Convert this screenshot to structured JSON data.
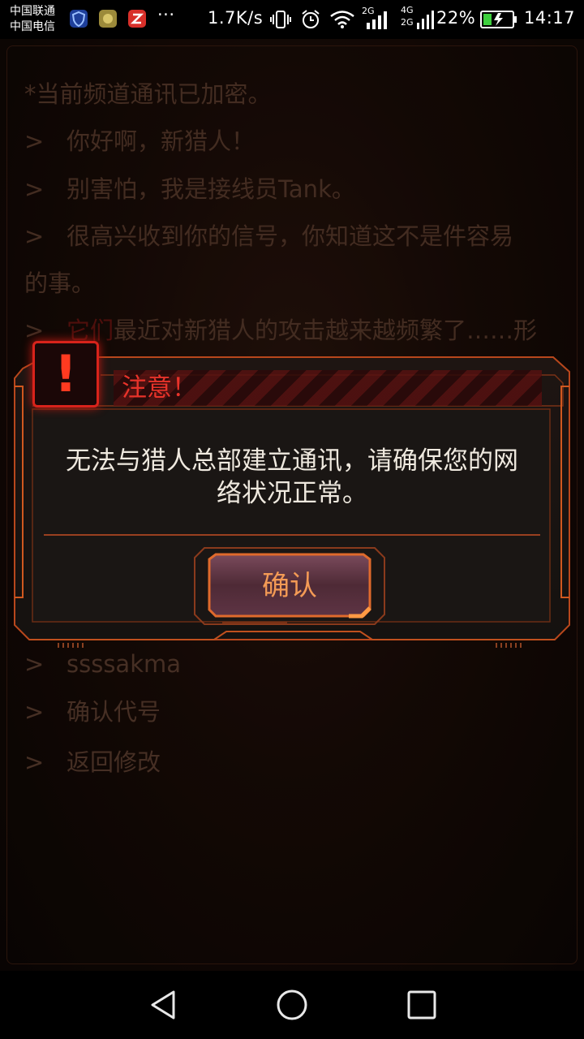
{
  "status_bar": {
    "carrier_1": "中国联通",
    "carrier_2": "中国电信",
    "more": "···",
    "net_speed": "1.7K/s",
    "net_2g": "2G",
    "net_4g": "4G",
    "net_2g_b": "2G",
    "battery": "22%",
    "time": "14:17"
  },
  "chat": {
    "lines": [
      {
        "prefix": "",
        "text": "*当前频道通讯已加密。"
      },
      {
        "prefix": ">",
        "text": "你好啊，新猎人！"
      },
      {
        "prefix": ">",
        "text": "别害怕，我是接线员Tank。"
      },
      {
        "prefix": ">",
        "text": "很高兴收到你的信号，你知道这不是件容易"
      },
      {
        "prefix": "",
        "text": "的事。"
      },
      {
        "prefix": ">",
        "red": "它们",
        "text": "最近对新猎人的攻击越来越频繁了……形"
      }
    ],
    "options": [
      {
        "prefix": ">",
        "text": "ssssakma"
      },
      {
        "prefix": ">",
        "text": "确认代号"
      },
      {
        "prefix": ">",
        "text": "返回修改"
      }
    ]
  },
  "dialog": {
    "alert_icon": "exclamation-icon",
    "title": "注意！",
    "message_line1": "无法与猎人总部建立通讯，请确保您的网",
    "message_line2": "络状况正常。",
    "confirm_label": "确认"
  },
  "colors": {
    "accent": "#e8332a",
    "frame": "#c0501e",
    "button_text": "#f39a55"
  }
}
